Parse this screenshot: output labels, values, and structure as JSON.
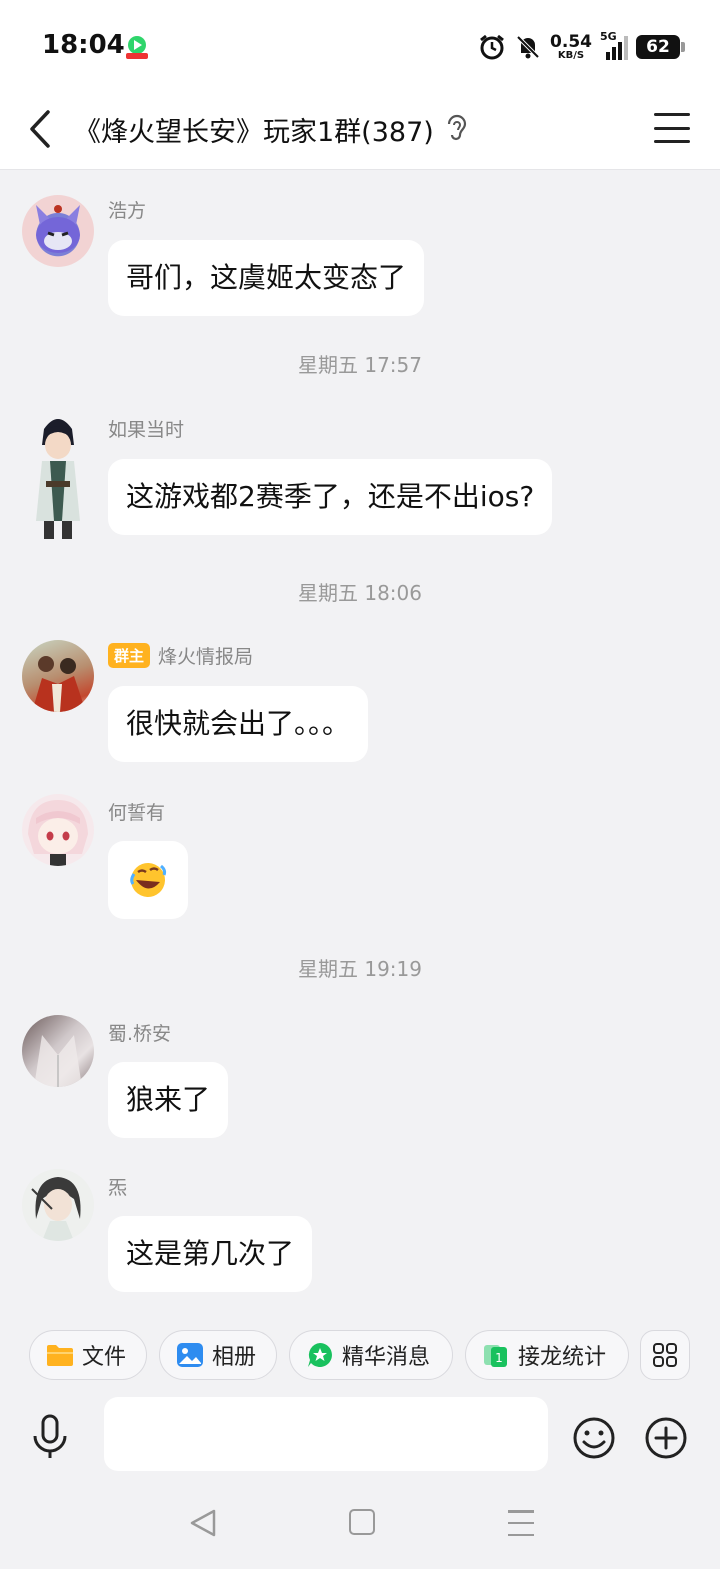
{
  "status_bar": {
    "time": "18:04",
    "net_speed_value": "0.54",
    "net_speed_unit": "KB/S",
    "network": "5G",
    "battery": "62"
  },
  "header": {
    "title": "《烽火望长安》玩家1群(387)"
  },
  "messages": [
    {
      "sender": "浩方",
      "text": "哥们，这虞姬太变态了"
    },
    {
      "separator": "星期五 17:57"
    },
    {
      "sender": "如果当时",
      "text": "这游戏都2赛季了，还是不出ios?"
    },
    {
      "separator": "星期五 18:06"
    },
    {
      "sender": "烽火情报局",
      "badge": "群主",
      "text": "很快就会出了。。。"
    },
    {
      "sender": "何誓有",
      "sticker": "laughing-crying-emoji"
    },
    {
      "separator": "星期五 19:19"
    },
    {
      "sender": "蜀.桥安",
      "text": "狼来了"
    },
    {
      "sender": "炁",
      "text": "这是第几次了"
    }
  ],
  "quick_actions": [
    {
      "label": "文件",
      "icon": "folder-icon",
      "color": "#ffb21f"
    },
    {
      "label": "相册",
      "icon": "photo-icon",
      "color": "#2e8cf0"
    },
    {
      "label": "精华消息",
      "icon": "star-bubble-icon",
      "color": "#19c15e"
    },
    {
      "label": "接龙统计",
      "icon": "chain-stat-icon",
      "color": "#19c15e"
    }
  ],
  "input": {
    "placeholder": ""
  }
}
